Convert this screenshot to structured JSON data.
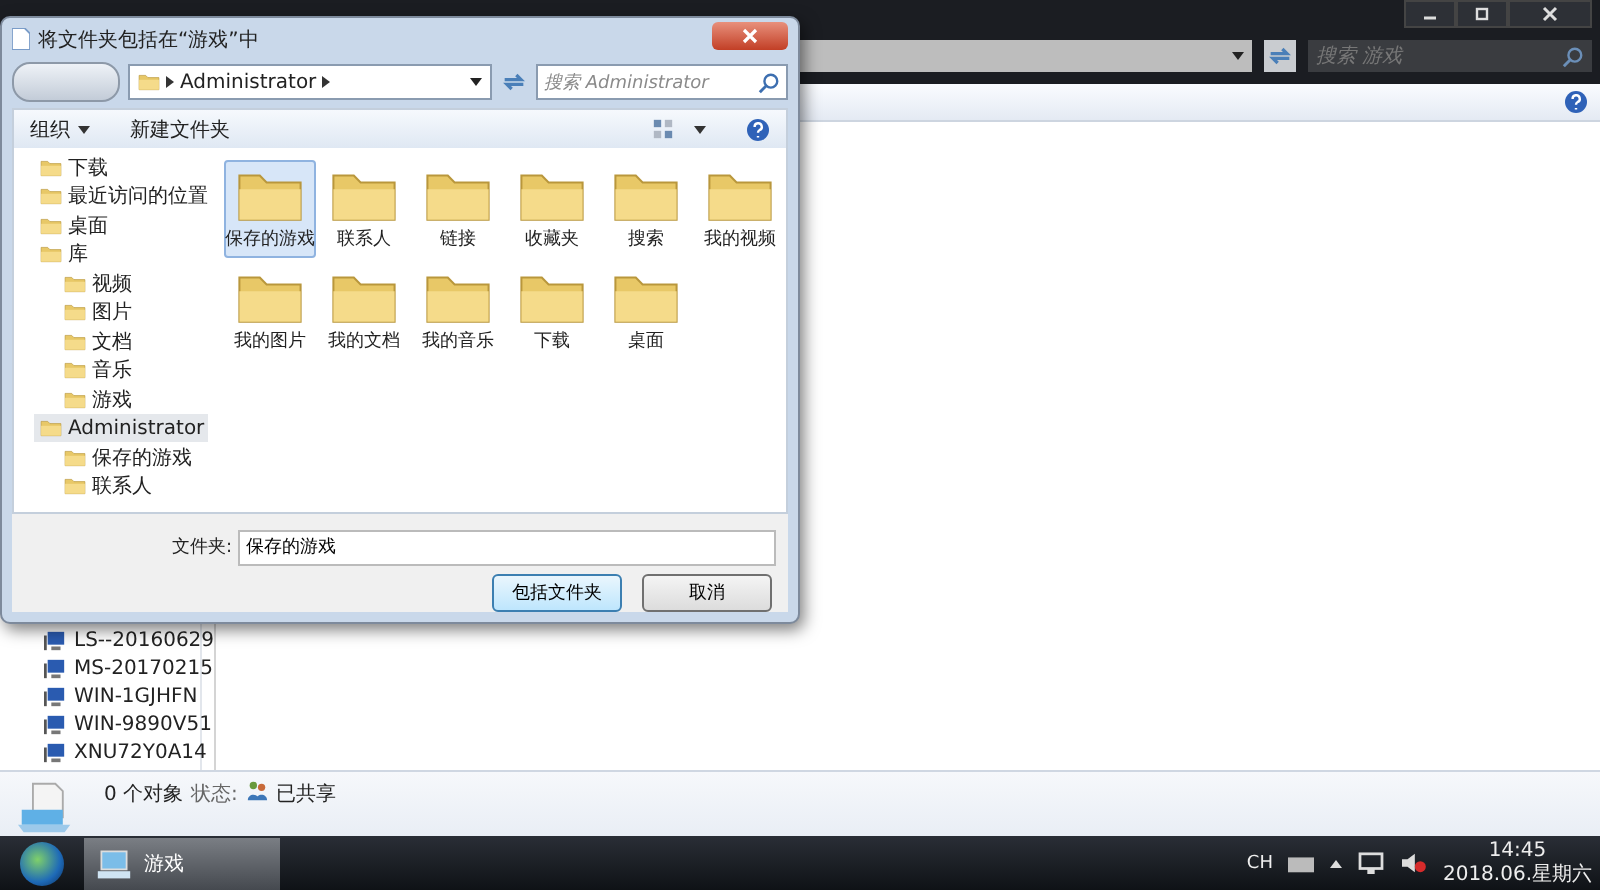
{
  "explorer": {
    "search_placeholder": "搜索 游戏",
    "nav_items": [
      {
        "label": "LS--20160629"
      },
      {
        "label": "MS-20170215"
      },
      {
        "label": "WIN-1GJHFN"
      },
      {
        "label": "WIN-9890V51"
      },
      {
        "label": "XNU72Y0A14"
      }
    ],
    "status": {
      "count": "0 个对象",
      "state_label": "状态:",
      "state_value": "已共享"
    }
  },
  "dialog": {
    "title": "将文件夹包括在“游戏”中",
    "breadcrumb": "Administrator",
    "search_placeholder": "搜索 Administrator",
    "toolbar": [
      {
        "label": "组织",
        "dropdown": true
      },
      {
        "label": "新建文件夹",
        "dropdown": false
      }
    ],
    "nav_tree": [
      {
        "label": "下载",
        "selected": false
      },
      {
        "label": "最近访问的位置",
        "selected": false
      },
      {
        "label": "桌面",
        "selected": false
      },
      {
        "label": "库",
        "selected": false,
        "children": [
          {
            "label": "视频",
            "selected": false
          },
          {
            "label": "图片",
            "selected": false
          },
          {
            "label": "文档",
            "selected": false
          },
          {
            "label": "音乐",
            "selected": false
          },
          {
            "label": "游戏",
            "selected": false
          }
        ]
      },
      {
        "label": "Administrator",
        "selected": true,
        "children": [
          {
            "label": "保存的游戏",
            "selected": false
          },
          {
            "label": "联系人",
            "selected": false
          }
        ]
      }
    ],
    "folders": [
      {
        "label": "保存的游戏",
        "selected": true
      },
      {
        "label": "联系人",
        "selected": false
      },
      {
        "label": "链接",
        "selected": false
      },
      {
        "label": "收藏夹",
        "selected": false
      },
      {
        "label": "搜索",
        "selected": false
      },
      {
        "label": "我的视频",
        "selected": false
      },
      {
        "label": "我的图片",
        "selected": false
      },
      {
        "label": "我的文档",
        "selected": false
      },
      {
        "label": "我的音乐",
        "selected": false
      },
      {
        "label": "下载",
        "selected": false
      },
      {
        "label": "桌面",
        "selected": false
      }
    ],
    "folder_field": {
      "label": "文件夹:",
      "value": "保存的游戏"
    },
    "buttons": [
      {
        "label": "包括文件夹",
        "default": true
      },
      {
        "label": "取消",
        "default": false
      }
    ]
  },
  "taskbar": {
    "items": [
      {
        "label": "游戏",
        "selected": true
      }
    ],
    "input_indicator": "CH",
    "time": "14:45",
    "date": "2018.06.星期六"
  }
}
